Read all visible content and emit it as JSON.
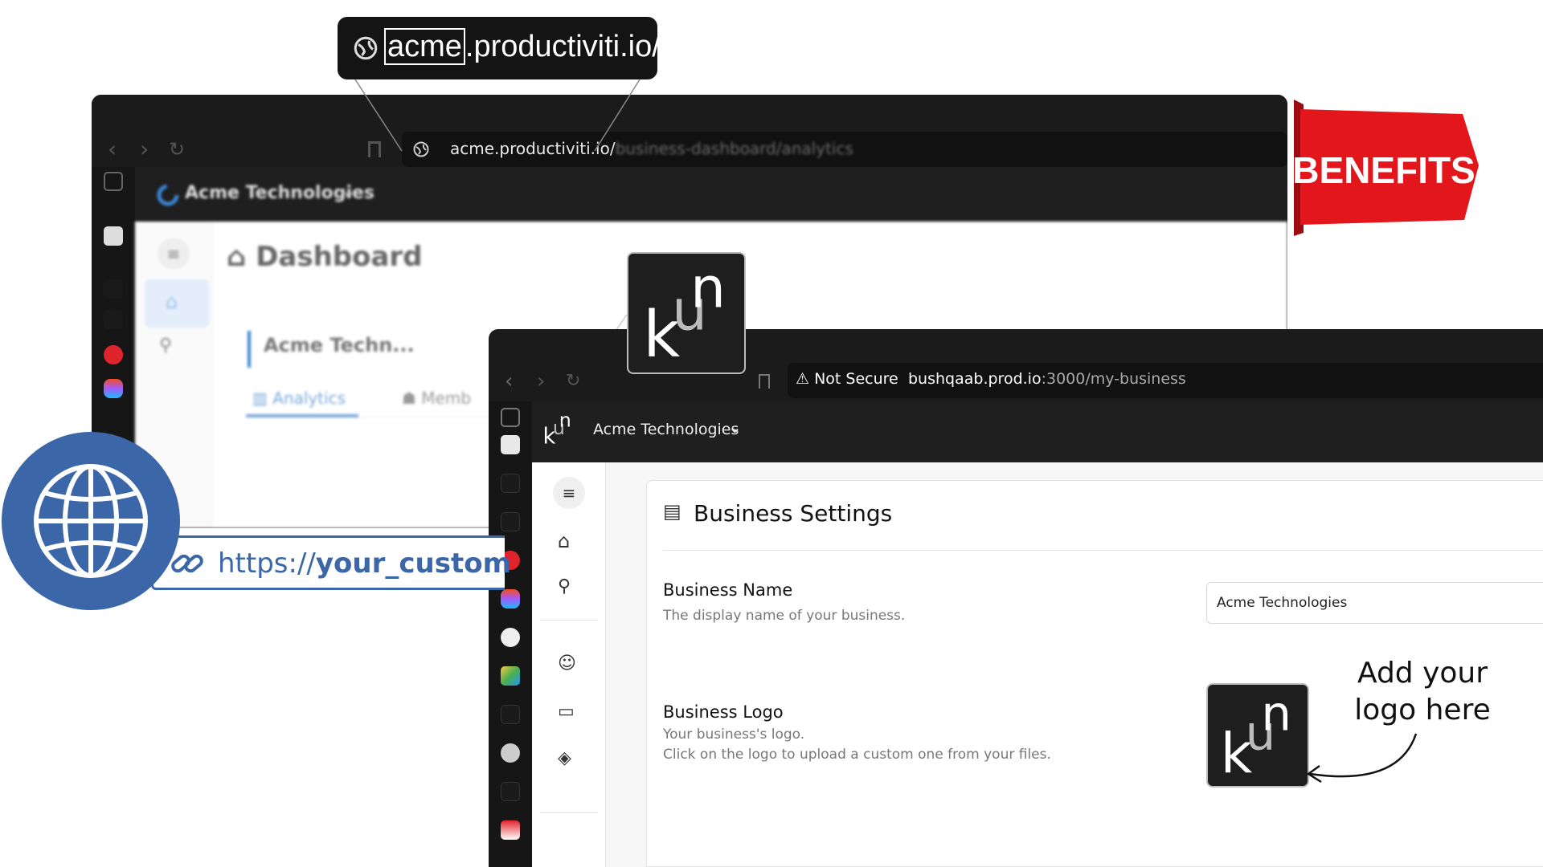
{
  "callout": {
    "subdomain": "acme",
    "domain_rest": ".productiviti.io/"
  },
  "back_window": {
    "url_host": "acme.productiviti.io/",
    "url_path": "business-dashboard/analytics",
    "org_name": "Acme Technologies",
    "page_title": "Dashboard",
    "card_name": "Acme Techn...",
    "tabs": [
      "Analytics",
      "Memb"
    ]
  },
  "ribbon": {
    "label": "BENEFITS",
    "color": "#e3161c"
  },
  "custom_url": {
    "prefix": "https://",
    "domain": "your_custom"
  },
  "front_window": {
    "security_label": "Not Secure",
    "url_host": "bushqaab.prod.io",
    "url_rest": ":3000/my-business",
    "org_name": "Acme Technologies",
    "page_title": "Business Settings",
    "fields": {
      "name_label": "Business Name",
      "name_desc": "The display name of your business.",
      "name_value": "Acme Technologies",
      "logo_label": "Business Logo",
      "logo_desc_1": "Your business's logo.",
      "logo_desc_2": "Click on the logo to upload a custom one from your files."
    }
  },
  "logo_text": {
    "k": "k",
    "u": "u",
    "n": "n"
  },
  "annotation": {
    "line1": "Add your",
    "line2": "logo here"
  },
  "colors": {
    "accent_blue": "#3b66a7",
    "dark": "#1b1b1b"
  }
}
